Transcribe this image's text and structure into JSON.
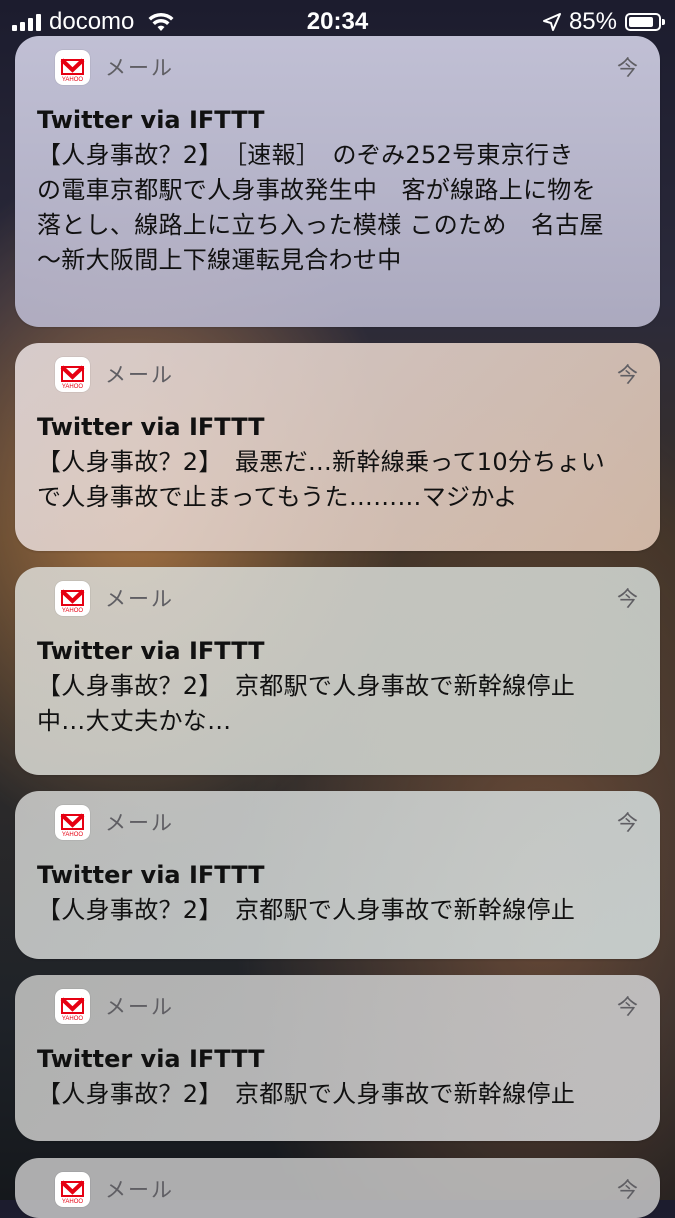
{
  "status_bar": {
    "carrier": "docomo",
    "time": "20:34",
    "battery_percent": "85%",
    "battery_level": 0.85
  },
  "notifications": [
    {
      "app": "メール",
      "time": "今",
      "title": "Twitter via IFTTT",
      "body_lines": [
        "【人身事故？2】　［速報］　のぞみ252号東京行き",
        "の電車京都駅で人身事故発生中　客が線路上に物を",
        "落とし、線路上に立ち入った模様 このため　名古屋",
        "～新大阪間上下線運転見合わせ中"
      ]
    },
    {
      "app": "メール",
      "time": "今",
      "title": "Twitter via IFTTT",
      "body_lines": [
        "【人身事故？2】　最悪だ…新幹線乗って10分ちょい",
        "で人身事故で止まってもうた………マジかよ"
      ]
    },
    {
      "app": "メール",
      "time": "今",
      "title": "Twitter via IFTTT",
      "body_lines": [
        "【人身事故？2】　京都駅で人身事故で新幹線停止",
        "中…大丈夫かな…"
      ]
    },
    {
      "app": "メール",
      "time": "今",
      "title": "Twitter via IFTTT",
      "body_lines": [
        "【人身事故？2】　京都駅で人身事故で新幹線停止"
      ]
    },
    {
      "app": "メール",
      "time": "今",
      "title": "Twitter via IFTTT",
      "body_lines": [
        "【人身事故？2】　京都駅で人身事故で新幹線停止"
      ]
    },
    {
      "app": "メール",
      "time": "今"
    }
  ]
}
